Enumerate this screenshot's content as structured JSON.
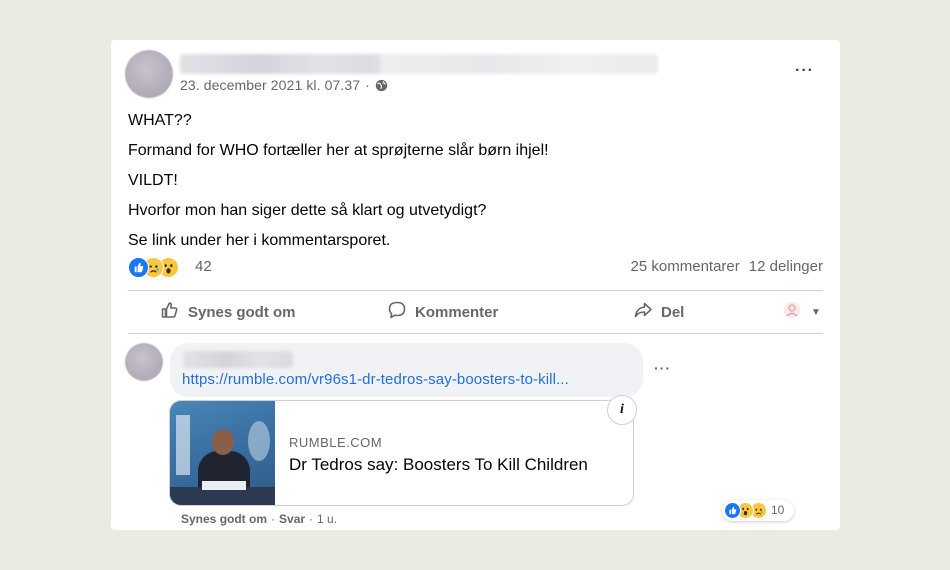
{
  "post": {
    "timestamp": "23. december 2021 kl. 07.37",
    "timestamp_sep": "·",
    "more_label": "···",
    "lines": [
      "WHAT??",
      "Formand for WHO fortæller her at sprøjterne slår børn ihjel!",
      "VILDT!",
      "Hvorfor mon han siger dette så klart og utvetydigt?",
      "Se link under her i kommentarsporet."
    ],
    "reactions": {
      "count": "42",
      "types": [
        "like-icon",
        "sad-icon",
        "wow-icon"
      ]
    },
    "comments_count": "25 kommentarer",
    "shares_count": "12 delinger"
  },
  "actions": {
    "like": "Synes godt om",
    "comment": "Kommenter",
    "share": "Del"
  },
  "comment": {
    "link": "https://rumble.com/vr96s1-dr-tedros-say-boosters-to-kill...",
    "more_label": "···",
    "preview": {
      "domain": "RUMBLE.COM",
      "title": "Dr Tedros say: Boosters To Kill Children",
      "info": "i"
    },
    "meta": {
      "like": "Synes godt om",
      "sep1": "·",
      "reply": "Svar",
      "sep2": "·",
      "time": "1 u."
    },
    "reactions": {
      "count": "10",
      "types": [
        "like-icon",
        "wow-icon",
        "sad-icon"
      ]
    }
  },
  "colors": {
    "background": "#ecebe2",
    "card": "#ffffff",
    "link": "#216fdb",
    "secondary_text": "#65676b",
    "like_blue": "#1877f2",
    "emoji_yellow": "#f7c740"
  }
}
